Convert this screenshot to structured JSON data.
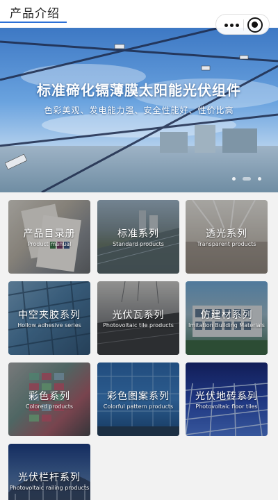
{
  "header": {
    "title": "产品介绍"
  },
  "banner": {
    "title": "标准碲化镉薄膜太阳能光伏组件",
    "subtitle": "色彩美观、发电能力强、安全性能好、性价比高",
    "slide_count": 3,
    "active_slide": 2
  },
  "products": [
    {
      "cn": "产品目录册",
      "en": "Product manual"
    },
    {
      "cn": "标准系列",
      "en": "Standard products"
    },
    {
      "cn": "透光系列",
      "en": "Transparent  products"
    },
    {
      "cn": "中空夹胶系列",
      "en": "Hollow adhesive series"
    },
    {
      "cn": "光伏瓦系列",
      "en": "Photovoltaic tile  products"
    },
    {
      "cn": "仿建材系列",
      "en": "Imitation Building Materials"
    },
    {
      "cn": "彩色系列",
      "en": "Colored products"
    },
    {
      "cn": "彩色图案系列",
      "en": "Colorful pattern products"
    },
    {
      "cn": "光伏地砖系列",
      "en": "Photovoltaic floor tiles"
    },
    {
      "cn": "光伏栏杆系列",
      "en": "Photovoltaic railing products"
    }
  ],
  "icons": {
    "more": "more-dots-icon",
    "close": "close-circle-icon"
  }
}
